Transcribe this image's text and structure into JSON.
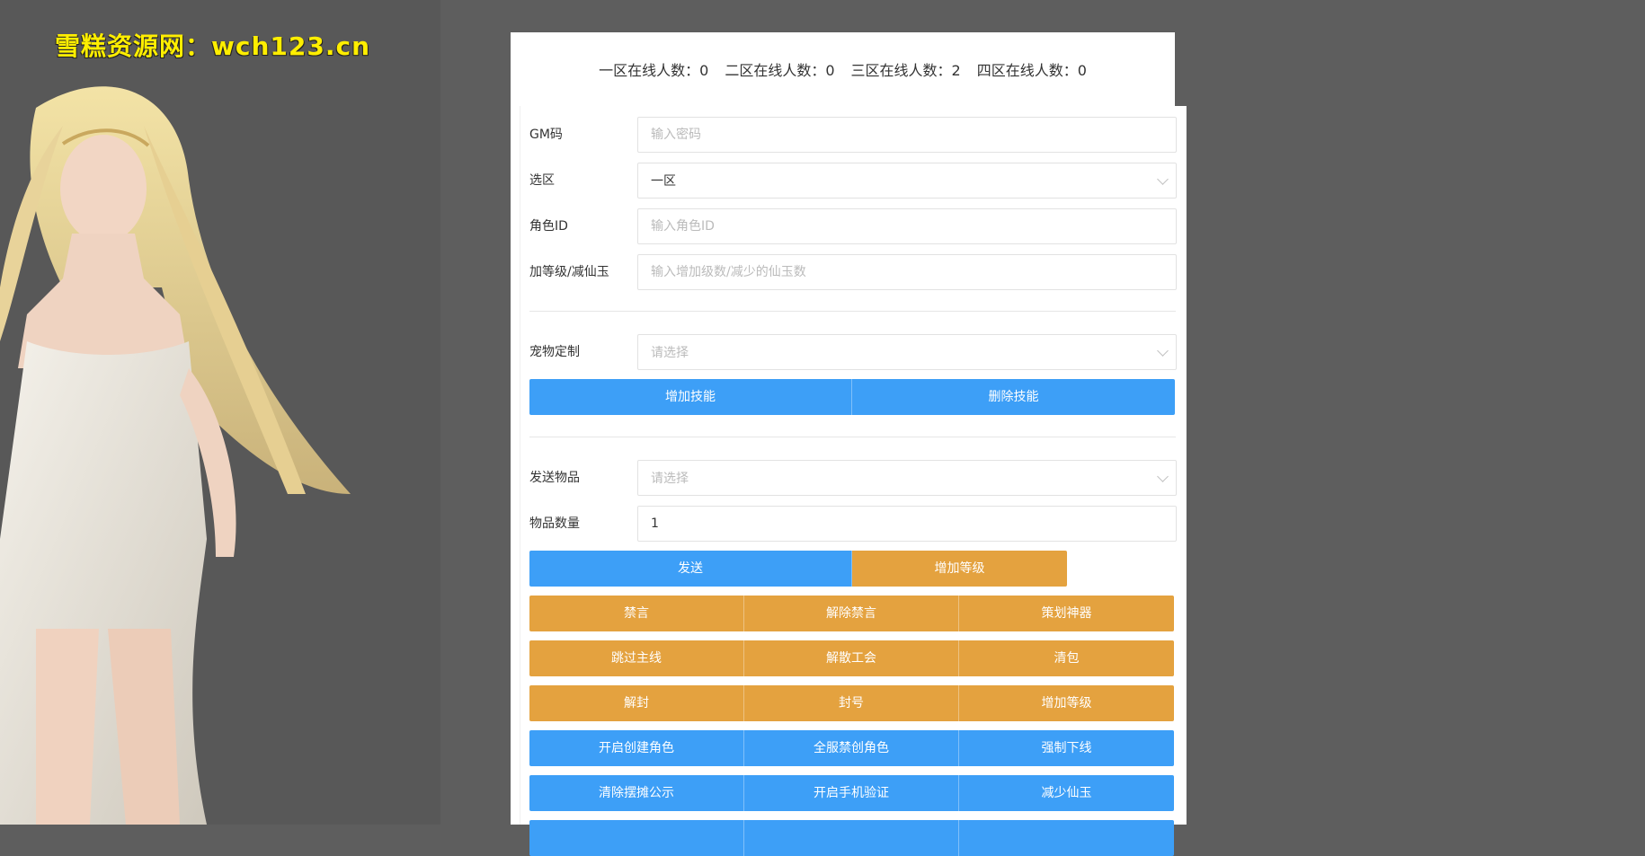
{
  "watermark": "雪糕资源网：wch123.cn",
  "online": {
    "z1": "一区在线人数：0",
    "z2": "二区在线人数：0",
    "z3": "三区在线人数：2",
    "z4": "四区在线人数：0"
  },
  "form": {
    "gm_label": "GM码",
    "gm_placeholder": "输入密码",
    "zone_label": "选区",
    "zone_value": "一区",
    "role_label": "角色ID",
    "role_placeholder": "输入角色ID",
    "level_label": "加等级/减仙玉",
    "level_placeholder": "输入增加级数/减少的仙玉数",
    "pet_label": "宠物定制",
    "pet_placeholder": "请选择",
    "item_label": "发送物品",
    "item_placeholder": "请选择",
    "qty_label": "物品数量",
    "qty_value": "1"
  },
  "buttons": {
    "add_skill": "增加技能",
    "del_skill": "删除技能",
    "send": "发送",
    "add_level_1": "增加等级",
    "mute": "禁言",
    "unmute": "解除禁言",
    "plan_artifact": "策划神器",
    "skip_main": "跳过主线",
    "disband_guild": "解散工会",
    "clear_bag": "清包",
    "unseal": "解封",
    "ban": "封号",
    "add_level_2": "增加等级",
    "enable_create": "开启创建角色",
    "disable_create": "全服禁创角色",
    "force_offline": "强制下线",
    "clear_stall": "清除摆摊公示",
    "enable_phone": "开启手机验证",
    "reduce_jade": "减少仙玉"
  },
  "colors": {
    "blue": "#3d9ff7",
    "orange": "#e4a23f",
    "watermark": "#ffee00",
    "background": "#5e5e5e"
  }
}
